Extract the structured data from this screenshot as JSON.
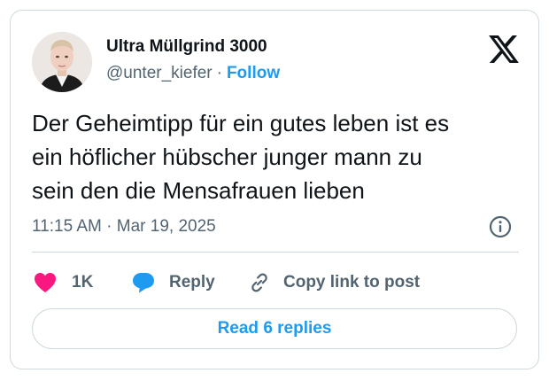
{
  "author": {
    "display_name": "Ultra Müllgrind 3000",
    "handle": "@unter_kiefer",
    "separator": "·",
    "follow_label": "Follow"
  },
  "tweet": {
    "lines": [
      "Der Geheimtipp für ein gutes leben ist es",
      "ein höflicher hübscher junger mann zu",
      "sein den die Mensafrauen lieben"
    ],
    "timestamp": "11:15 AM · Mar 19, 2025"
  },
  "actions": {
    "like_count": "1K",
    "reply_label": "Reply",
    "copy_label": "Copy link to post"
  },
  "read_replies_label": "Read 6 replies",
  "icons": {
    "logo": "x-logo-icon",
    "info": "info-icon",
    "like": "heart-icon",
    "reply": "speech-bubble-icon",
    "copy": "link-icon"
  },
  "colors": {
    "accent": "#1d9bf0",
    "like": "#f91880",
    "text": "#0f1419",
    "secondary": "#536471",
    "border": "#cfd9de"
  }
}
